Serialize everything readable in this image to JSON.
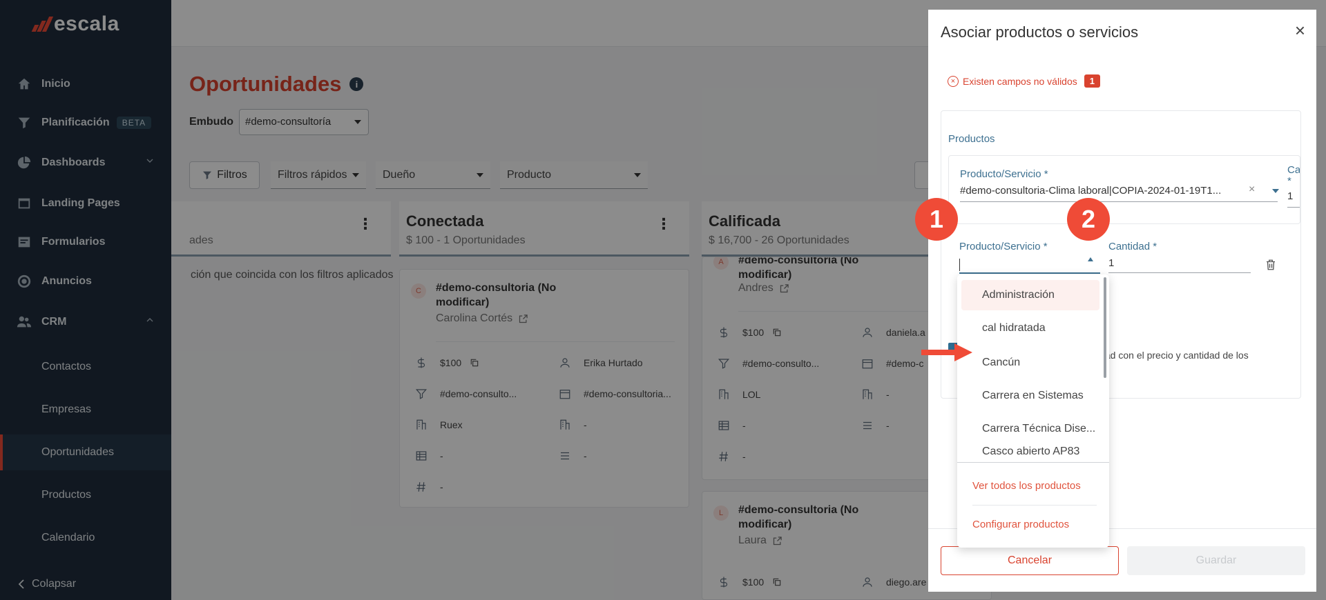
{
  "app": {
    "brand": "escala"
  },
  "sidebar": {
    "items": [
      {
        "label": "Inicio",
        "icon": "home-icon"
      },
      {
        "label": "Planificación",
        "icon": "funnel-icon",
        "badge": "BETA"
      },
      {
        "label": "Dashboards",
        "icon": "pie-chart-icon"
      },
      {
        "label": "Landing Pages",
        "icon": "browser-icon"
      },
      {
        "label": "Formularios",
        "icon": "form-icon"
      },
      {
        "label": "Anuncios",
        "icon": "target-icon"
      },
      {
        "label": "CRM",
        "icon": "users-icon"
      }
    ],
    "crm_sub": [
      "Contactos",
      "Empresas",
      "Oportunidades",
      "Productos",
      "Calendario"
    ],
    "collapse_label": "Colapsar"
  },
  "main": {
    "title": "Oportunidades",
    "funnel_label": "Embudo",
    "funnel_value": "#demo-consultoría",
    "filters_label": "Filtros",
    "quick_filters": "Filtros rápidos",
    "owner_filter": "Dueño",
    "product_filter": "Producto",
    "columns": [
      {
        "title": "",
        "subtitle": "ades"
      },
      {
        "title": "Conectada",
        "subtitle": "$ 100 - 1 Oportunidades"
      },
      {
        "title": "Calificada",
        "subtitle": "$ 16,700 - 26 Oportunidades"
      }
    ],
    "empty_message": "ción que coincida con los filtros aplicados",
    "card1": {
      "avatar": "C",
      "title": "#demo-consultoria (No modificar)",
      "owner": "Carolina Cortés",
      "fields": [
        "$100",
        "Erika Hurtado",
        "#demo-consulto...",
        "#demo-consultoria...",
        "Ruex",
        "-",
        "-",
        "-",
        "-"
      ]
    },
    "card2": {
      "avatar": "A",
      "title": "#demo-consultoria (No modificar)",
      "owner": "Andres",
      "fields": [
        "$100",
        "daniela.a",
        "#demo-consulto...",
        "#demo-c",
        "LOL",
        "-",
        "-",
        "-",
        "-"
      ]
    },
    "card3": {
      "avatar": "L",
      "title": "#demo-consultoria (No modificar)",
      "owner": "Laura",
      "fields": [
        "$100",
        "diego.are"
      ]
    }
  },
  "modal": {
    "title": "Asociar productos o servicios",
    "error_text": "Existen campos no válidos",
    "error_count": "1",
    "products_label": "Productos",
    "row1": {
      "product_label": "Producto/Servicio *",
      "product_value": "#demo-consultoria-Clima laboral|COPIA-2024-01-19T1...",
      "qty_label": "Cantid",
      "qty_label_star": "*",
      "qty_value": "1"
    },
    "row2": {
      "product_label": "Producto/Servicio *",
      "qty_label": "Cantidad *",
      "qty_value": "1"
    },
    "checkbox_text": "idad con el precio y cantidad de los",
    "cancel_label": "Cancelar",
    "save_label": "Guardar"
  },
  "dropdown": {
    "options": [
      "Administración",
      "cal hidratada",
      "Cancún",
      "Carrera en Sistemas",
      "Carrera Técnica Dise...",
      "Casco abierto AP83"
    ],
    "view_all": "Ver todos los productos",
    "configure": "Configurar productos"
  },
  "annotations": {
    "step1": "1",
    "step2": "2"
  },
  "colors": {
    "accent": "#ef4b37",
    "sidebar_bg": "#1f2d3d",
    "label_blue": "#3d7090"
  }
}
